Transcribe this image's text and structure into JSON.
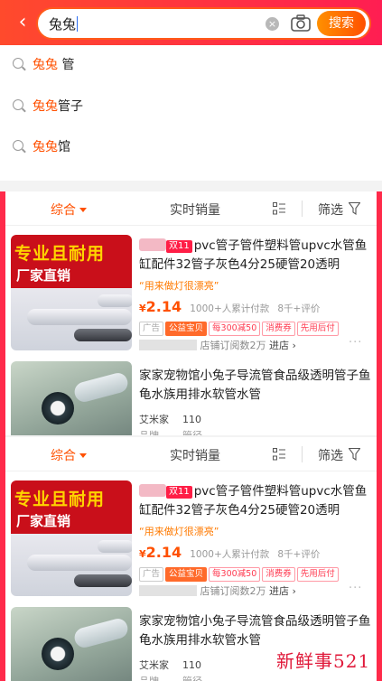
{
  "search": {
    "query": "兔兔",
    "button_label": "搜索"
  },
  "suggestions": [
    {
      "highlight": "兔兔",
      "rest": " 管"
    },
    {
      "highlight": "兔兔",
      "rest": "管子"
    },
    {
      "highlight": "兔兔",
      "rest": "馆"
    }
  ],
  "filters": {
    "sort": "综合",
    "sales": "实时销量",
    "filter": "筛选"
  },
  "product1": {
    "badge": "双11",
    "title": "pvc管子管件塑料管upvc水管鱼缸配件32管子灰色4分25硬管20透明",
    "slogan": "“用来做灯很漂亮”",
    "price_symbol": "¥",
    "price": "2.14",
    "sold": "1000+人累计付款",
    "reviews": "8千+评价",
    "tags": [
      "广告",
      "公益宝贝",
      "每300减50",
      "消费券",
      "先用后付"
    ],
    "shop_stat": "店铺订阅数2万",
    "enter": "进店 ›",
    "more": "···",
    "thumb_line1": "专业且耐用",
    "thumb_line2": "厂家直销"
  },
  "product2": {
    "title": "家家宠物馆小兔子导流管食品级透明管子鱼龟水族用排水软管水管",
    "attrs": [
      {
        "key": "艾米家",
        "value": "110"
      },
      {
        "key": "品牌",
        "value": "管径"
      }
    ]
  },
  "watermark": "新鲜事521",
  "colors": {
    "accent": "#ff5000",
    "header": "#ff2a4a"
  },
  "icons": [
    "back-icon",
    "clear-icon",
    "camera-icon",
    "search-icon",
    "grid-view-icon",
    "funnel-icon"
  ]
}
